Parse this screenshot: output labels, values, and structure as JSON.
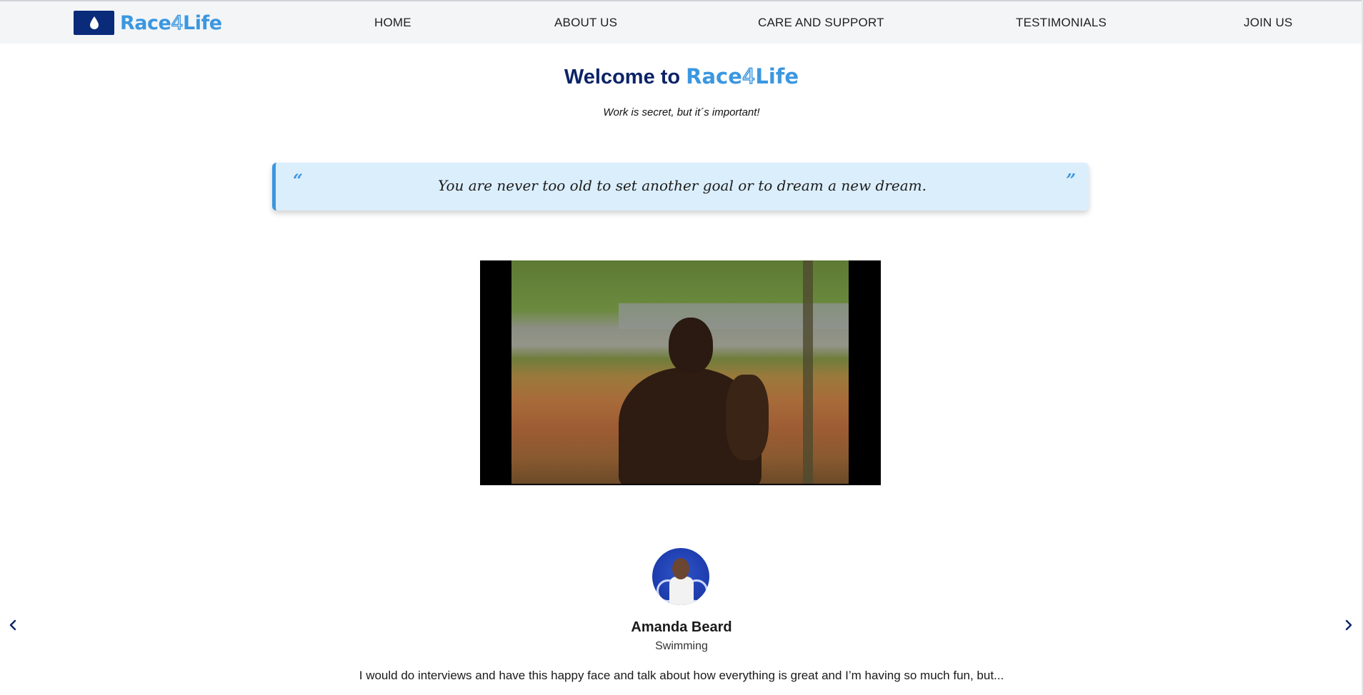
{
  "brand": {
    "name_part1": "Race",
    "name_digit": "4",
    "name_part2": "Life",
    "logo_icon": "water-drop-icon",
    "colors": {
      "navy": "#0a2a7a",
      "blue": "#3b97e0"
    }
  },
  "nav": {
    "items": [
      {
        "label": "HOME"
      },
      {
        "label": "ABOUT US"
      },
      {
        "label": "CARE AND SUPPORT"
      },
      {
        "label": "TESTIMONIALS"
      },
      {
        "label": "JOIN US"
      }
    ]
  },
  "hero": {
    "welcome_prefix": "Welcome to",
    "tagline": "Work is secret, but it´s important!"
  },
  "quote": {
    "open_mark": "“",
    "text": "You are never too old to set another goal or to dream a new dream.",
    "close_mark": "”"
  },
  "testimonial": {
    "name": "Amanda Beard",
    "sport": "Swimming",
    "excerpt": "I would do interviews and have this happy face and talk about how everything is great and I’m having so much fun, but...",
    "prev_icon": "chevron-left-icon",
    "next_icon": "chevron-right-icon"
  }
}
